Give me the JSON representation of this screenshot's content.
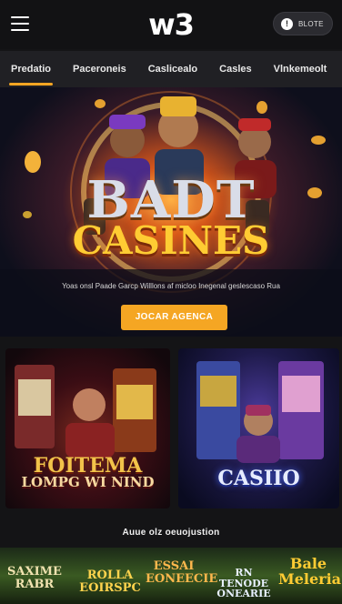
{
  "header": {
    "logo": "w3",
    "pill_icon": "!",
    "pill_label": "BLOTE"
  },
  "tabs": [
    {
      "label": "Predatio",
      "active": true
    },
    {
      "label": "Paceroneis",
      "active": false
    },
    {
      "label": "Caslicealo",
      "active": false
    },
    {
      "label": "Casles",
      "active": false
    },
    {
      "label": "Vlnkemeolt",
      "active": false
    }
  ],
  "hero": {
    "title": "BADT",
    "subtitle": "CASINES",
    "tagline": "Yoas onsl Paade Garcp Willlons af micloo Inegenal geslescaso Rua",
    "cta_label": "JOCAR AGENCA"
  },
  "cards": [
    {
      "line1": "FOITEMA",
      "line2": "LOMPG WI NIND"
    },
    {
      "line1": "CASIIO"
    }
  ],
  "section": {
    "title": "Auue olz oeuojustion"
  },
  "strip": [
    {
      "text": "SAXIME RABR",
      "color": "#f1e3b0"
    },
    {
      "text": "ROLLA EOIRSPC",
      "color": "#ffd34d"
    },
    {
      "text": "ESSAI EONEECIE",
      "color": "#ffb84d"
    },
    {
      "text": "RN TENODE ONEARIE",
      "color": "#e8f0ff"
    },
    {
      "text": "Bale Meleria",
      "color": "#ffcc33"
    }
  ],
  "colors": {
    "accent": "#f5a623",
    "background": "#141416",
    "tabbar": "#202024"
  }
}
